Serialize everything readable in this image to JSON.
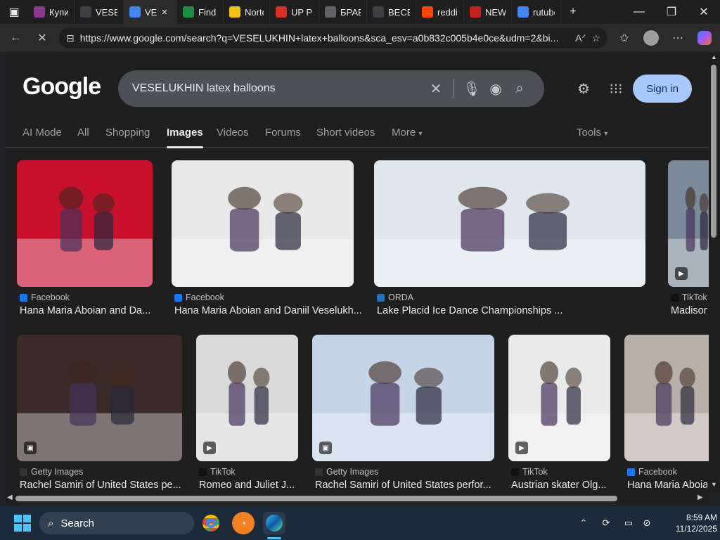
{
  "browser": {
    "tabs": [
      {
        "title": "Купит",
        "icon": "shopping-icon",
        "color": "#8b3a8f"
      },
      {
        "title": "VESEL",
        "icon": "search-icon",
        "color": "#3c4043"
      },
      {
        "title": "VE",
        "icon": "loading-icon",
        "color": "#4285f4",
        "active": true
      },
      {
        "title": "Find Y",
        "icon": "shield-check-icon",
        "color": "#1e8e3e"
      },
      {
        "title": "Norto",
        "icon": "norton-icon",
        "color": "#f4c20d"
      },
      {
        "title": "UP Ph",
        "icon": "up-icon",
        "color": "#d93025"
      },
      {
        "title": "БРАВС",
        "icon": "play-icon",
        "color": "#5f6368"
      },
      {
        "title": "ВЕСЕЛ",
        "icon": "search-icon",
        "color": "#3c4043"
      },
      {
        "title": "reddit",
        "icon": "reddit-icon",
        "color": "#ff4500"
      },
      {
        "title": "NEW-",
        "icon": "doc-icon",
        "color": "#c5221f"
      },
      {
        "title": "rutube",
        "icon": "loading-icon",
        "color": "#4285f4"
      }
    ],
    "new_tab": "+",
    "url": "https://www.google.com/search?q=VESELUKHIN+latex+balloons&sca_esv=a0b832c005b4e0ce&udm=2&bi..."
  },
  "google": {
    "logo": "Google",
    "query": "VESELUKHIN latex balloons",
    "sign_in": "Sign in",
    "tabs": [
      "AI Mode",
      "All",
      "Shopping",
      "Images",
      "Videos",
      "Forums",
      "Short videos",
      "More",
      "Tools"
    ],
    "active_tab": "Images"
  },
  "results": [
    {
      "source": "Facebook",
      "title": "Hana Maria Aboian and Da...",
      "bg": "#c8102e",
      "fav": "#1877f2",
      "badge": ""
    },
    {
      "source": "Facebook",
      "title": "Hana Maria Aboian and Daniil Veselukh...",
      "bg": "#e8e8e8",
      "fav": "#1877f2",
      "badge": ""
    },
    {
      "source": "ORDA",
      "title": "Lake Placid Ice Dance Championships ...",
      "bg": "#dfe6ee",
      "fav": "#2a6fb0",
      "badge": ""
    },
    {
      "source": "TikTok",
      "title": "Madison C",
      "bg": "#7a8a99",
      "fav": "#111111",
      "badge": "▶"
    },
    {
      "source": "Getty Images",
      "title": "Rachel Samiri of United States pe...",
      "bg": "#3a2a28",
      "fav": "#333333",
      "badge": "▣"
    },
    {
      "source": "TikTok",
      "title": "Romeo and Juliet J...",
      "bg": "#d9d9d9",
      "fav": "#111111",
      "badge": "▶"
    },
    {
      "source": "Getty Images",
      "title": "Rachel Samiri of United States perfor...",
      "bg": "#c6d4e8",
      "fav": "#333333",
      "badge": "▣"
    },
    {
      "source": "TikTok",
      "title": "Austrian skater Olg...",
      "bg": "#eaeaea",
      "fav": "#111111",
      "badge": "▶"
    },
    {
      "source": "Facebook",
      "title": "Hana Maria Aboia",
      "bg": "#b8b0a8",
      "fav": "#1877f2",
      "badge": ""
    }
  ],
  "taskbar": {
    "search": "Search",
    "time": "8:59 AM",
    "date": "11/12/2025"
  }
}
